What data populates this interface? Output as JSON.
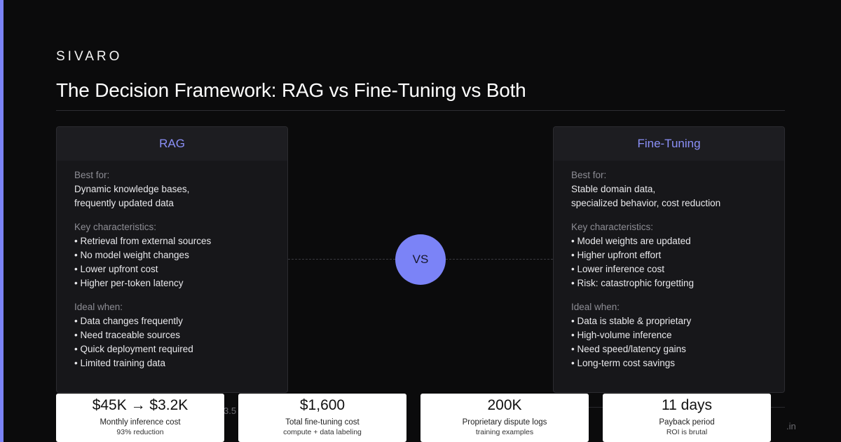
{
  "brand": "SIVARO",
  "title": "The Decision Framework: RAG vs Fine-Tuning vs Both",
  "vs_label": "VS",
  "ghost_left": "3.5",
  "ghost_right": ".in",
  "colors": {
    "accent": "#7b83f7",
    "background": "#0b0b0c",
    "card": "#17171a"
  },
  "rag": {
    "title": "RAG",
    "best_for_label": "Best for:",
    "best_for_lines": [
      "Dynamic knowledge bases,",
      "frequently updated data"
    ],
    "key_label": "Key characteristics:",
    "key_items": [
      "• Retrieval from external sources",
      "• No model weight changes",
      "• Lower upfront cost",
      "• Higher per-token latency"
    ],
    "ideal_label": "Ideal when:",
    "ideal_items": [
      "• Data changes frequently",
      "• Need traceable sources",
      "• Quick deployment required",
      "• Limited training data"
    ]
  },
  "ft": {
    "title": "Fine-Tuning",
    "best_for_label": "Best for:",
    "best_for_lines": [
      "Stable domain data,",
      "specialized behavior, cost reduction"
    ],
    "key_label": "Key characteristics:",
    "key_items": [
      "• Model weights are updated",
      "• Higher upfront effort",
      "• Lower inference cost",
      "• Risk: catastrophic forgetting"
    ],
    "ideal_label": "Ideal when:",
    "ideal_items": [
      "• Data is stable & proprietary",
      "• High-volume inference",
      "• Need speed/latency gains",
      "• Long-term cost savings"
    ]
  },
  "stats": [
    {
      "value": "$45K → $3.2K",
      "label": "Monthly inference cost",
      "sub": "93% reduction"
    },
    {
      "value": "$1,600",
      "label": "Total fine-tuning cost",
      "sub": "compute + data labeling"
    },
    {
      "value": "200K",
      "label": "Proprietary dispute logs",
      "sub": "training examples"
    },
    {
      "value": "11 days",
      "label": "Payback period",
      "sub": "ROI is brutal"
    }
  ]
}
